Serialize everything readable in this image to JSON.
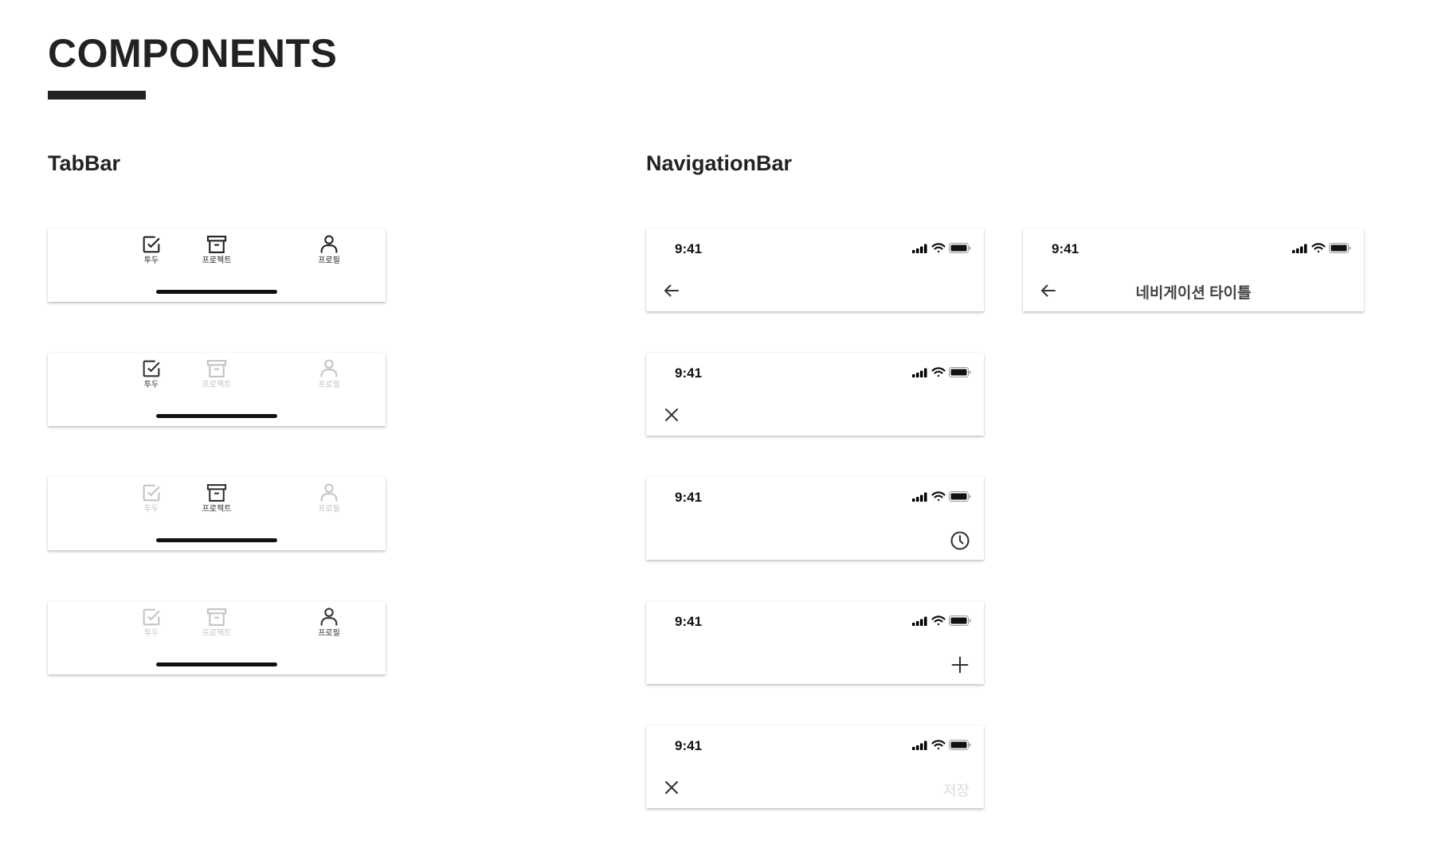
{
  "page": {
    "title": "COMPONENTS"
  },
  "sections": {
    "tabbar": "TabBar",
    "navigationbar": "NavigationBar"
  },
  "tabbar_variants": [
    {
      "tabs": [
        {
          "label": "투두",
          "icon": "checkbox-icon",
          "active": true
        },
        {
          "label": "프로젝트",
          "icon": "archive-icon",
          "active": true
        },
        {
          "label": "프로필",
          "icon": "person-icon",
          "active": true
        }
      ]
    },
    {
      "tabs": [
        {
          "label": "투두",
          "icon": "checkbox-icon",
          "active": true
        },
        {
          "label": "프로젝트",
          "icon": "archive-icon",
          "active": false
        },
        {
          "label": "프로필",
          "icon": "person-icon",
          "active": false
        }
      ]
    },
    {
      "tabs": [
        {
          "label": "투두",
          "icon": "checkbox-icon",
          "active": false
        },
        {
          "label": "프로젝트",
          "icon": "archive-icon",
          "active": true
        },
        {
          "label": "프로필",
          "icon": "person-icon",
          "active": false
        }
      ]
    },
    {
      "tabs": [
        {
          "label": "투두",
          "icon": "checkbox-icon",
          "active": false
        },
        {
          "label": "프로젝트",
          "icon": "archive-icon",
          "active": false
        },
        {
          "label": "프로필",
          "icon": "person-icon",
          "active": true
        }
      ]
    }
  ],
  "navbar_variants": [
    {
      "time": "9:41",
      "left_icon": "arrow-left-icon",
      "right_icon": "",
      "title": "",
      "action": ""
    },
    {
      "time": "9:41",
      "left_icon": "close-icon",
      "right_icon": "",
      "title": "",
      "action": ""
    },
    {
      "time": "9:41",
      "left_icon": "",
      "right_icon": "clock-icon",
      "title": "",
      "action": ""
    },
    {
      "time": "9:41",
      "left_icon": "",
      "right_icon": "plus-icon",
      "title": "",
      "action": ""
    },
    {
      "time": "9:41",
      "left_icon": "close-icon",
      "right_icon": "",
      "title": "",
      "action": "저장"
    },
    {
      "time": "9:41",
      "left_icon": "arrow-left-icon",
      "right_icon": "",
      "title": "네비게이션 타이틀",
      "action": ""
    }
  ],
  "colors": {
    "active": "#333333",
    "inactive": "#c4c4c4",
    "disabled_action": "#dadada",
    "text": "#222222"
  }
}
